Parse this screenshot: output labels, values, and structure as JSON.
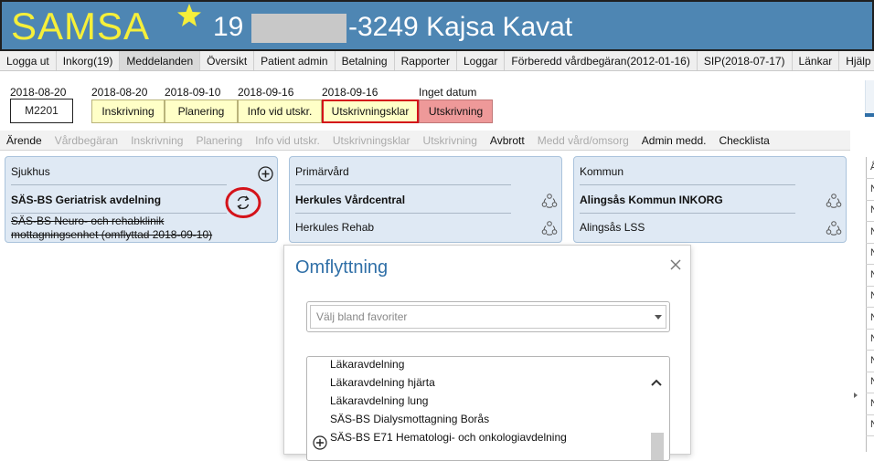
{
  "header": {
    "app_name": "SAMSA",
    "patient_id_prefix": "19",
    "patient_id_suffix": "-3249 Kajsa Kavat",
    "header_color": "#4e86b3",
    "logo_color": "#f5ef3a"
  },
  "menu": [
    {
      "label": "Logga ut"
    },
    {
      "label": "Inkorg(19)"
    },
    {
      "label": "Meddelanden"
    },
    {
      "label": "Översikt"
    },
    {
      "label": "Patient admin"
    },
    {
      "label": "Betalning"
    },
    {
      "label": "Rapporter"
    },
    {
      "label": "Loggar"
    },
    {
      "label": "Förberedd vårdbegäran(2012-01-16)"
    },
    {
      "label": "SIP(2018-07-17)"
    },
    {
      "label": "Länkar"
    },
    {
      "label": "Hjälp"
    }
  ],
  "case": {
    "date": "2018-08-20",
    "id": "M2201"
  },
  "stages": [
    {
      "date": "2018-08-20",
      "label": "Inskrivning"
    },
    {
      "date": "2018-09-10",
      "label": "Planering"
    },
    {
      "date": "2018-09-16",
      "label": "Info vid utskr."
    },
    {
      "date": "2018-09-16",
      "label": "Utskrivningsklar"
    },
    {
      "date": "Inget datum",
      "label": "Utskrivning"
    }
  ],
  "toolbar": [
    {
      "label": "Ärende"
    },
    {
      "label": "Vårdbegäran"
    },
    {
      "label": "Inskrivning"
    },
    {
      "label": "Planering"
    },
    {
      "label": "Info vid utskr."
    },
    {
      "label": "Utskrivningsklar"
    },
    {
      "label": "Utskrivning"
    },
    {
      "label": "Avbrott"
    },
    {
      "label": "Medd vård/omsorg"
    },
    {
      "label": "Admin medd."
    },
    {
      "label": "Checklista"
    }
  ],
  "panels": {
    "sjukhus": {
      "title": "Sjukhus",
      "unit": "SÄS-BS Geriatrisk avdelning",
      "moved_unit": "SÄS-BS Neuro- och rehabklinik mottagningsenhet (omflyttad 2018-09-10)"
    },
    "primarvard": {
      "title": "Primärvård",
      "unit": "Herkules Vårdcentral",
      "unit2": "Herkules Rehab"
    },
    "kommun": {
      "title": "Kommun",
      "unit": "Alingsås Kommun INKORG",
      "unit2": "Alingsås LSS"
    }
  },
  "dialog": {
    "title": "Omflyttning",
    "favorites_placeholder": "Välj bland favoriter",
    "units": [
      "Läkaravdelning",
      "Läkaravdelning hjärta",
      "Läkaravdelning lung",
      "SÄS-BS Dialysmottagning Borås",
      "SÄS-BS E71 Hematologi- och onkologiavdelning"
    ]
  },
  "right_grid_letters": [
    "Å",
    "N",
    "N",
    "N",
    "N",
    "N",
    "N",
    "N",
    "N",
    "N",
    "N",
    "N",
    "N"
  ]
}
